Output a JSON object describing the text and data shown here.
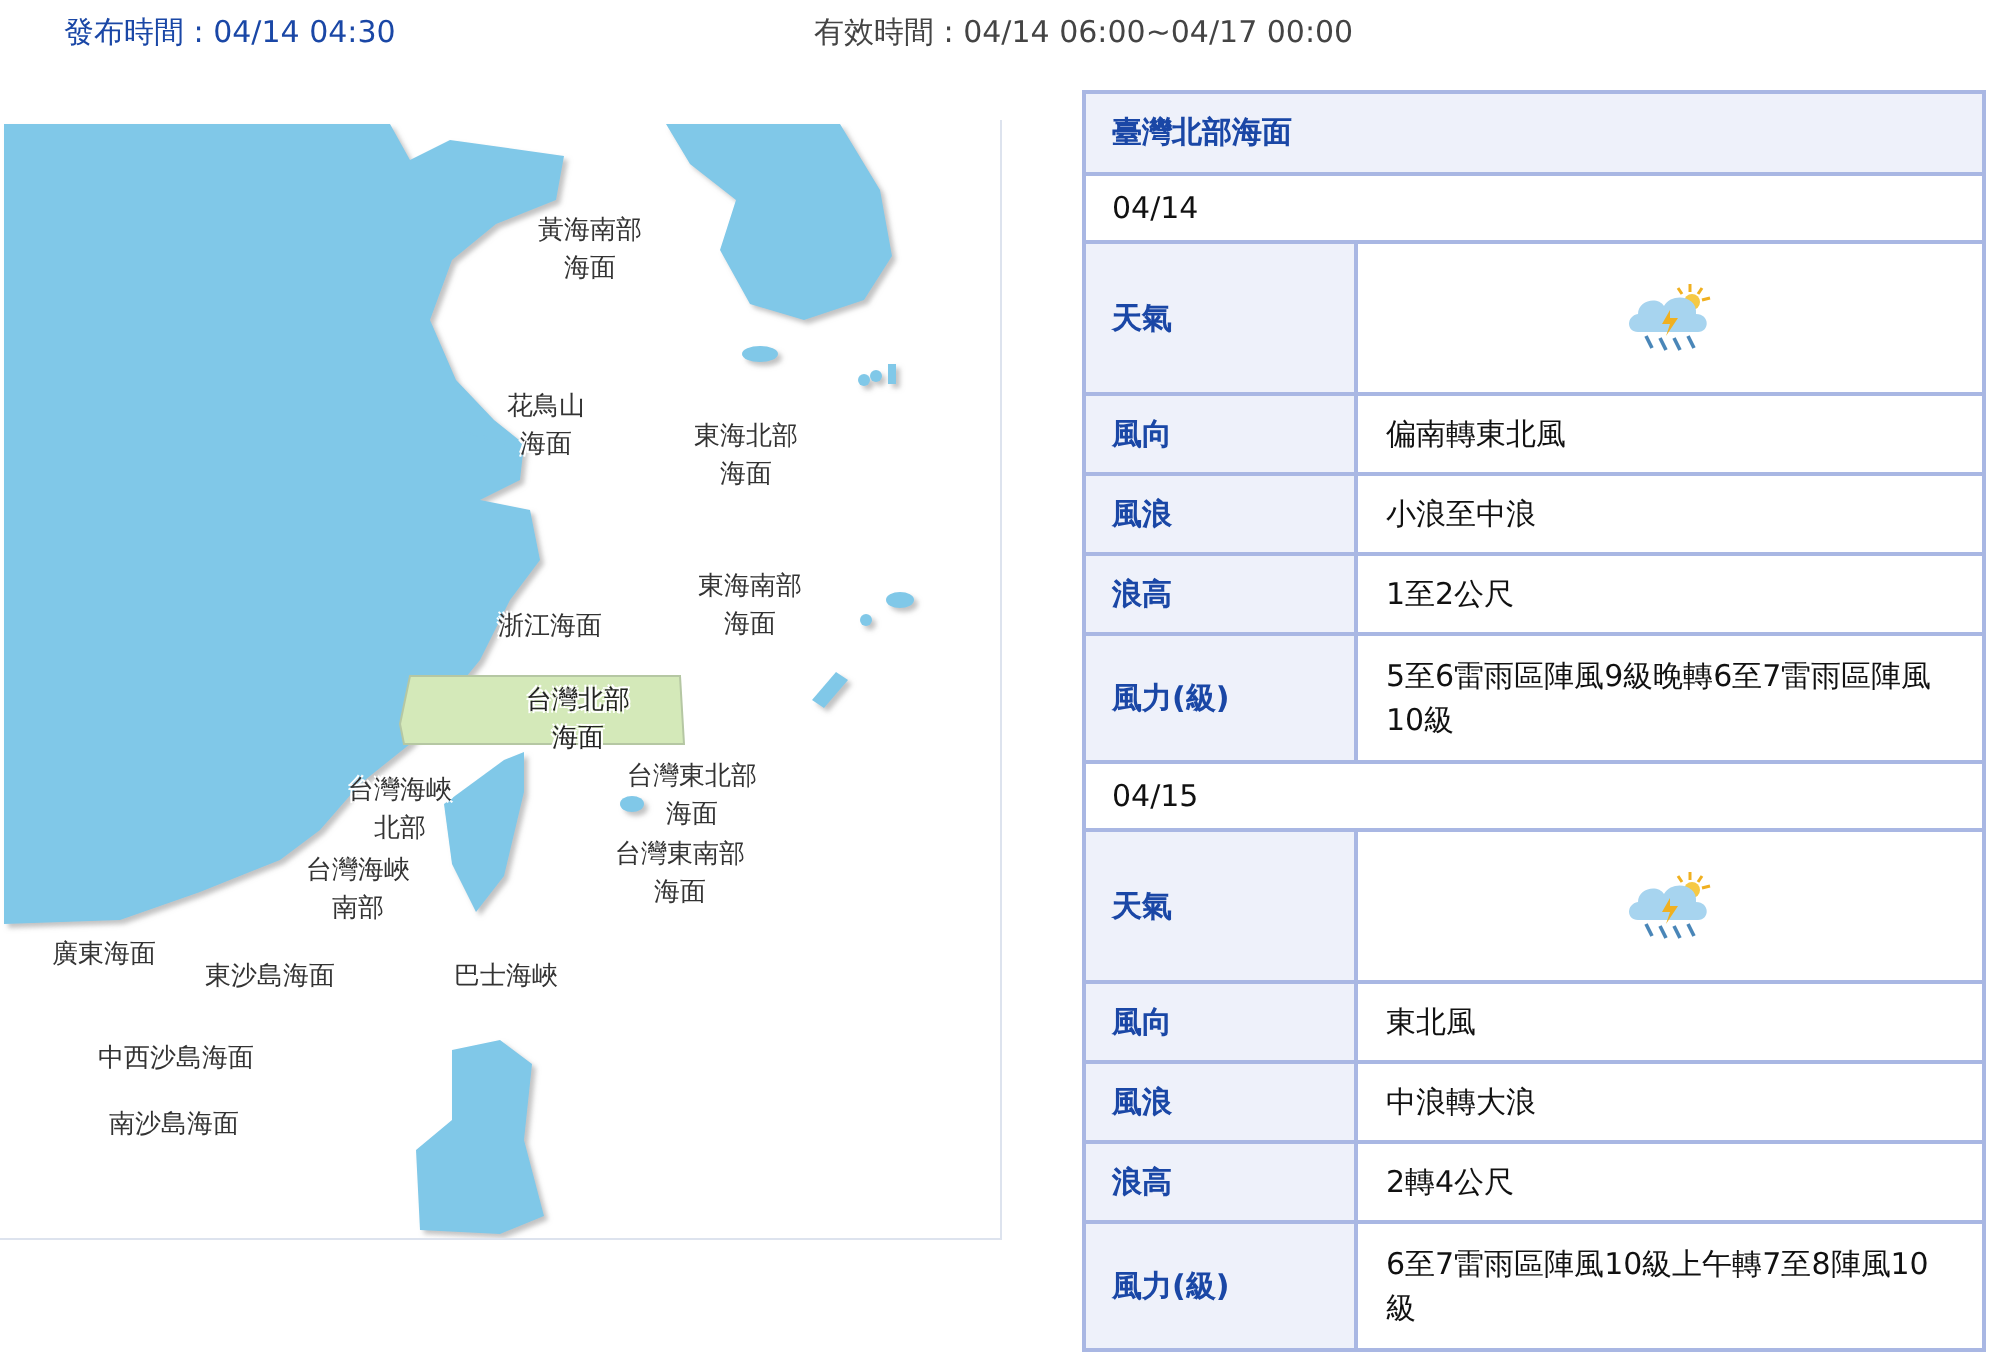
{
  "issued": "發布時間 : 04/14 04:30",
  "valid": "有效時間 : 04/14 06:00~04/17 00:00",
  "map": {
    "areas": [
      {
        "lines": [
          "黃海南部",
          "海面"
        ],
        "selected": false
      },
      {
        "lines": [
          "花鳥山",
          "海面"
        ],
        "selected": false
      },
      {
        "lines": [
          "東海北部",
          "海面"
        ],
        "selected": false
      },
      {
        "lines": [
          "浙江海面"
        ],
        "selected": false
      },
      {
        "lines": [
          "東海南部",
          "海面"
        ],
        "selected": false
      },
      {
        "lines": [
          "台灣北部",
          "海面"
        ],
        "selected": true
      },
      {
        "lines": [
          "台灣東北部",
          "海面"
        ],
        "selected": false
      },
      {
        "lines": [
          "台灣海峽",
          "北部"
        ],
        "selected": false
      },
      {
        "lines": [
          "台灣海峽",
          "南部"
        ],
        "selected": false
      },
      {
        "lines": [
          "台灣東南部",
          "海面"
        ],
        "selected": false
      },
      {
        "lines": [
          "廣東海面"
        ],
        "selected": false
      },
      {
        "lines": [
          "東沙島海面"
        ],
        "selected": false
      },
      {
        "lines": [
          "巴士海峽"
        ],
        "selected": false
      },
      {
        "lines": [
          "中西沙島海面"
        ],
        "selected": false
      },
      {
        "lines": [
          "南沙島海面"
        ],
        "selected": false
      }
    ]
  },
  "forecast": {
    "title": "臺灣北部海面",
    "days": [
      {
        "date": "04/14",
        "rows": [
          {
            "kind": "weather",
            "label": "天氣"
          },
          {
            "kind": "text",
            "label": "風向",
            "value": "偏南轉東北風"
          },
          {
            "kind": "text",
            "label": "風浪",
            "value": "小浪至中浪"
          },
          {
            "kind": "text",
            "label": "浪高",
            "value": "1至2公尺"
          },
          {
            "kind": "text",
            "label": "風力(級)",
            "value": "5至6雷雨區陣風9級晚轉6至7雷雨區陣風10級"
          }
        ]
      },
      {
        "date": "04/15",
        "rows": [
          {
            "kind": "weather",
            "label": "天氣"
          },
          {
            "kind": "text",
            "label": "風向",
            "value": "東北風"
          },
          {
            "kind": "text",
            "label": "風浪",
            "value": "中浪轉大浪"
          },
          {
            "kind": "text",
            "label": "浪高",
            "value": "2轉4公尺"
          },
          {
            "kind": "text",
            "label": "風力(級)",
            "value": "6至7雷雨區陣風10級上午轉7至8陣風10級"
          }
        ]
      }
    ]
  }
}
